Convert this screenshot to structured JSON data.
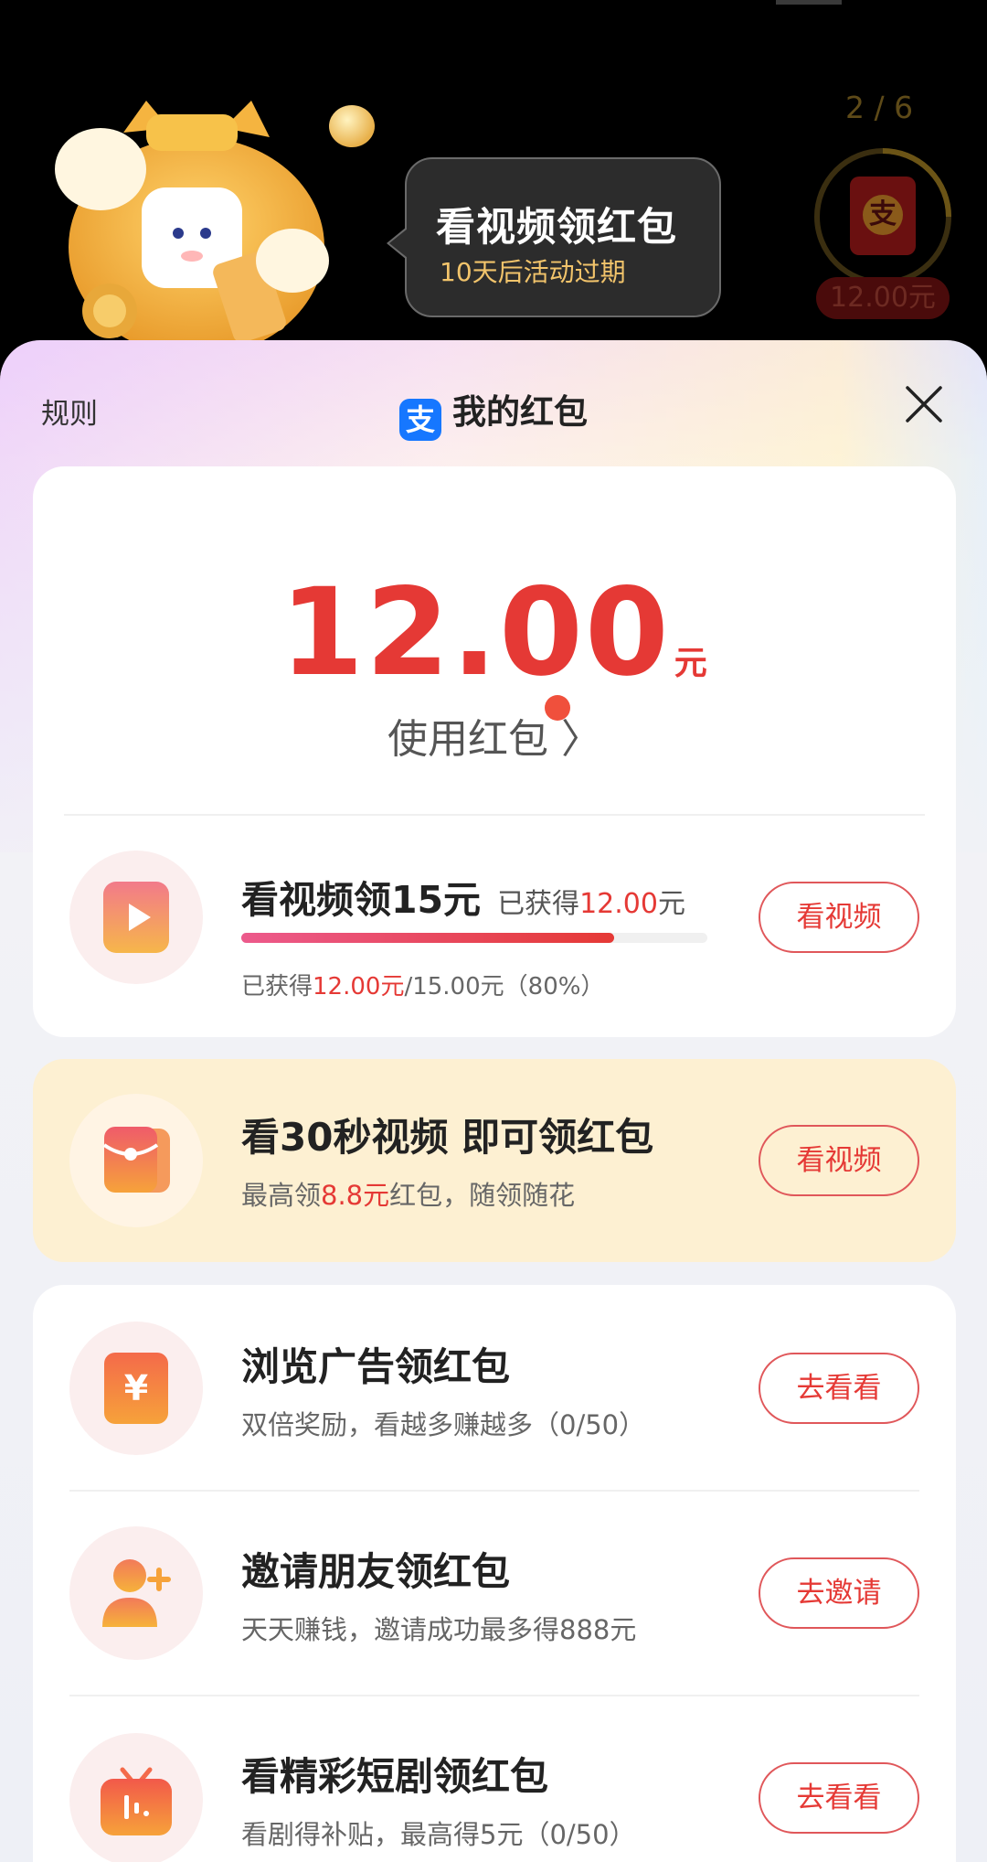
{
  "promo": {
    "bubble_title": "看视频领红包",
    "bubble_sub": "10天后活动过期",
    "progress_count": "2 / 6",
    "envelope_glyph": "支",
    "amount_pill": "12.00元"
  },
  "header": {
    "rules": "规则",
    "logo_glyph": "支",
    "title": "我的红包"
  },
  "balance": {
    "amount": "12.00",
    "unit": "元",
    "use_link": "使用红包 〉"
  },
  "video_task": {
    "title": "看视频领15元",
    "earned_label": "已获得",
    "earned_value": "12.00",
    "earned_unit": "元",
    "progress_prefix": "已获得",
    "progress_value": "12.00元",
    "progress_rest": "/15.00元（80%）",
    "progress_fraction": 0.8,
    "button": "看视频"
  },
  "short_video_task": {
    "title": "看30秒视频 即可领红包",
    "sub_prefix": "最高领",
    "sub_value": "8.8元",
    "sub_suffix": "红包，随领随花",
    "button": "看视频"
  },
  "tasks": [
    {
      "title": "浏览广告领红包",
      "sub": "双倍奖励，看越多赚越多（0/50）",
      "button": "去看看",
      "icon": "yuan-card-icon"
    },
    {
      "title": "邀请朋友领红包",
      "sub": "天天赚钱，邀请成功最多得888元",
      "button": "去邀请",
      "icon": "add-friend-icon"
    },
    {
      "title": "看精彩短剧领红包",
      "sub": "看剧得补贴，最高得5元（0/50）",
      "button": "去看看",
      "icon": "tv-icon"
    }
  ],
  "colors": {
    "accent": "#e53935",
    "brand_blue": "#1677ff",
    "highlight_card": "#fdf0d2"
  }
}
